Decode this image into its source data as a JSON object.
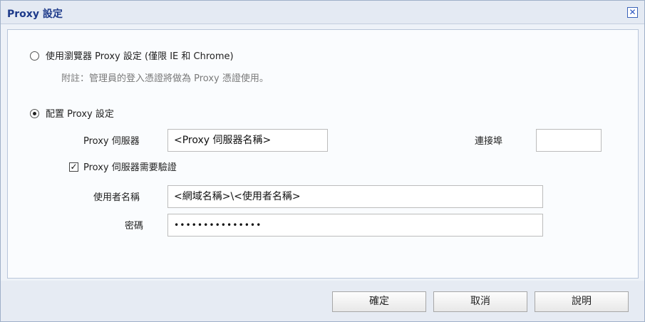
{
  "dialog": {
    "title": "Proxy 設定",
    "close_glyph": "✕"
  },
  "options": {
    "browser_proxy": {
      "label": "使用瀏覽器 Proxy 設定 (僅限 IE 和 Chrome)",
      "note": "附註：管理員的登入憑證將做為 Proxy 憑證使用。",
      "selected": false
    },
    "configure_proxy": {
      "label": "配置 Proxy 設定",
      "selected": true
    }
  },
  "form": {
    "server_label": "Proxy 伺服器",
    "server_value": "<Proxy 伺服器名稱>",
    "port_label": "連接埠",
    "port_value": "",
    "auth_checkbox_label": "Proxy 伺服器需要驗證",
    "auth_checked": true,
    "check_glyph": "✓",
    "username_label": "使用者名稱",
    "username_value": "<網域名稱>\\<使用者名稱>",
    "password_label": "密碼",
    "password_value": "•••••••••••••••"
  },
  "buttons": {
    "ok": "確定",
    "cancel": "取消",
    "help": "說明"
  }
}
